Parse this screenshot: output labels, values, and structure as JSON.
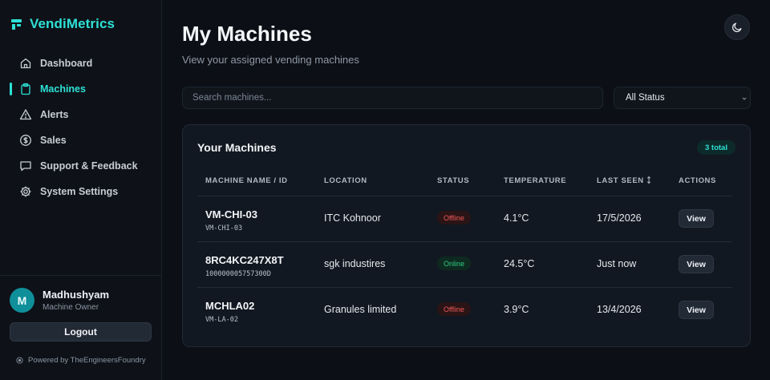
{
  "brand": {
    "name": "VendiMetrics",
    "color": "#2ee0d6"
  },
  "sidebar": {
    "items": [
      {
        "label": "Dashboard",
        "icon": "home-icon",
        "active": false
      },
      {
        "label": "Machines",
        "icon": "clipboard-icon",
        "active": true
      },
      {
        "label": "Alerts",
        "icon": "alert-triangle-icon",
        "active": false
      },
      {
        "label": "Sales",
        "icon": "dollar-circle-icon",
        "active": false
      },
      {
        "label": "Support & Feedback",
        "icon": "message-icon",
        "active": false
      },
      {
        "label": "System Settings",
        "icon": "gear-icon",
        "active": false
      }
    ]
  },
  "user": {
    "initial": "M",
    "name": "Madhushyam",
    "role": "Machine Owner",
    "logout_label": "Logout"
  },
  "footer": {
    "powered": "Powered by TheEngineersFoundry"
  },
  "header": {
    "title": "My Machines",
    "subtitle": "View your assigned vending machines",
    "theme_icon": "moon-icon"
  },
  "filters": {
    "search_placeholder": "Search machines...",
    "status_value": "All Status"
  },
  "table": {
    "title": "Your Machines",
    "total": "3 total",
    "columns": {
      "name": "MACHINE NAME / ID",
      "location": "LOCATION",
      "status": "STATUS",
      "temperature": "TEMPERATURE",
      "last_seen": "LAST SEEN",
      "actions": "ACTIONS"
    },
    "rows": [
      {
        "name": "VM-CHI-03",
        "id": "VM-CHI-03",
        "location": "ITC Kohnoor",
        "status": "Offline",
        "temperature": "4.1°C",
        "last_seen": "17/5/2026",
        "action": "View"
      },
      {
        "name": "8RC4KC247X8T",
        "id": "100000005757300D",
        "location": "sgk industires",
        "status": "Online",
        "temperature": "24.5°C",
        "last_seen": "Just now",
        "action": "View"
      },
      {
        "name": "MCHLA02",
        "id": "VM-LA-02",
        "location": "Granules limited",
        "status": "Offline",
        "temperature": "3.9°C",
        "last_seen": "13/4/2026",
        "action": "View"
      }
    ]
  },
  "colors": {
    "accent": "#2ee0d6",
    "offline": "#ef5a57",
    "online": "#2ecb7f",
    "background": "#0c1016"
  }
}
